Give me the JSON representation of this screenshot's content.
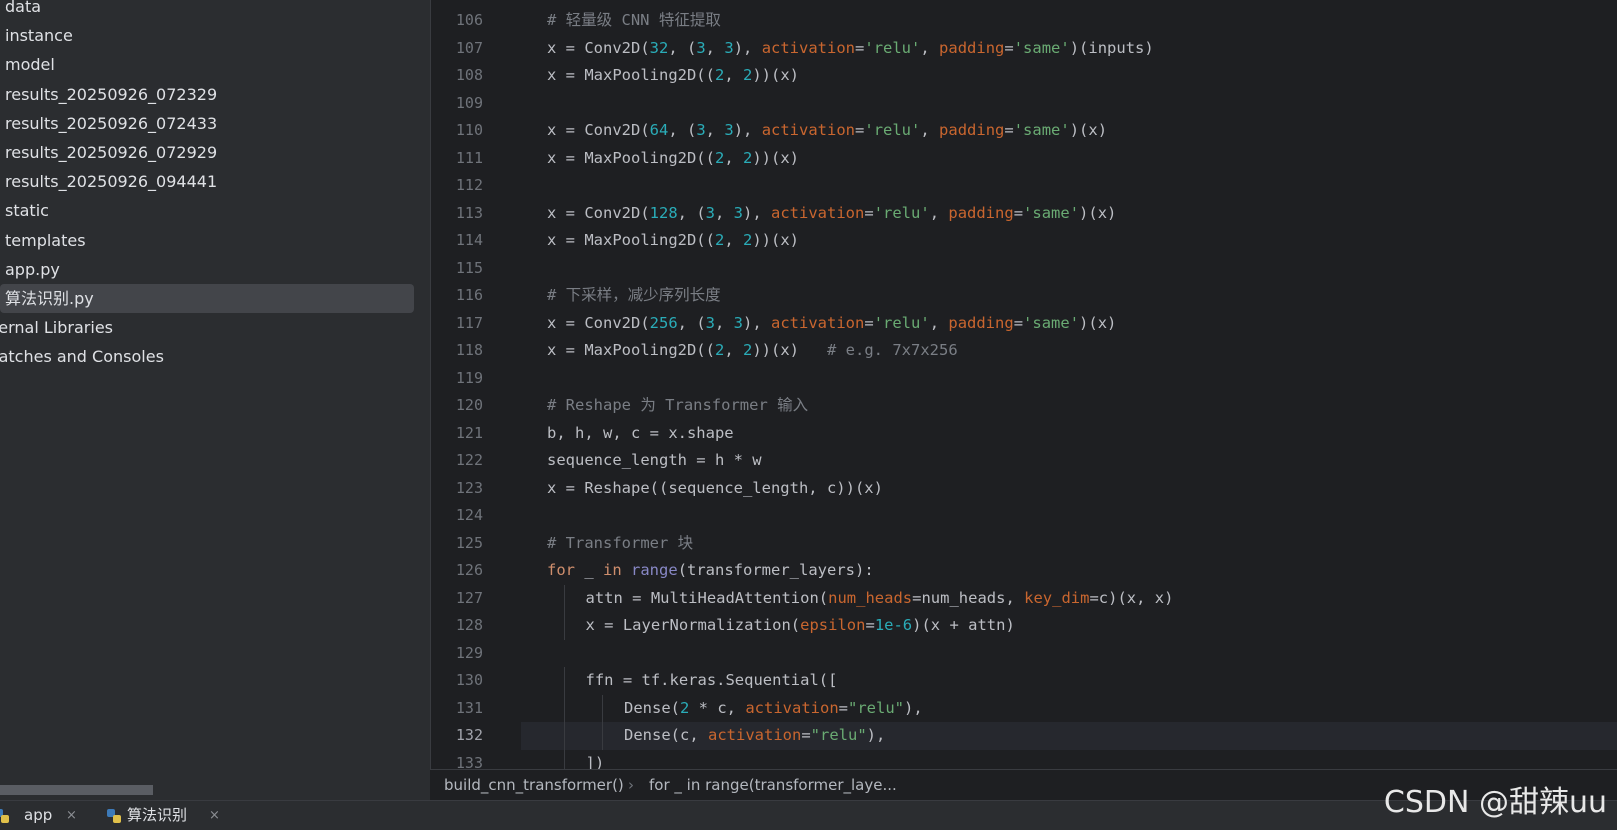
{
  "project_tree": {
    "items": [
      {
        "label": "data"
      },
      {
        "label": "instance"
      },
      {
        "label": "model"
      },
      {
        "label": "results_20250926_072329"
      },
      {
        "label": "results_20250926_072433"
      },
      {
        "label": "results_20250926_072929"
      },
      {
        "label": "results_20250926_094441"
      },
      {
        "label": "static"
      },
      {
        "label": "templates"
      },
      {
        "label": "app.py"
      },
      {
        "label": "算法识别.py"
      },
      {
        "label": "ternal Libraries"
      },
      {
        "label": "ratches and Consoles"
      }
    ],
    "selected": "算法识别.py"
  },
  "editor": {
    "current_line": 132,
    "lines": [
      {
        "n": "106",
        "indent": 1,
        "tokens": [
          [
            "c-cmt",
            "# 轻量级 CNN 特征提取"
          ]
        ]
      },
      {
        "n": "107",
        "indent": 1,
        "tokens": [
          [
            "c-plain",
            "x = Conv2D("
          ],
          [
            "c-num",
            "32"
          ],
          [
            "c-plain",
            ", ("
          ],
          [
            "c-num",
            "3"
          ],
          [
            "c-plain",
            ", "
          ],
          [
            "c-num",
            "3"
          ],
          [
            "c-plain",
            "), "
          ],
          [
            "c-param",
            "activation"
          ],
          [
            "c-plain",
            "="
          ],
          [
            "c-str",
            "'relu'"
          ],
          [
            "c-plain",
            ", "
          ],
          [
            "c-param",
            "padding"
          ],
          [
            "c-plain",
            "="
          ],
          [
            "c-str",
            "'same'"
          ],
          [
            "c-plain",
            ")(inputs)"
          ]
        ]
      },
      {
        "n": "108",
        "indent": 1,
        "tokens": [
          [
            "c-plain",
            "x = MaxPooling2D(("
          ],
          [
            "c-num",
            "2"
          ],
          [
            "c-plain",
            ", "
          ],
          [
            "c-num",
            "2"
          ],
          [
            "c-plain",
            "))(x)"
          ]
        ]
      },
      {
        "n": "109",
        "indent": 0,
        "tokens": []
      },
      {
        "n": "110",
        "indent": 1,
        "tokens": [
          [
            "c-plain",
            "x = Conv2D("
          ],
          [
            "c-num",
            "64"
          ],
          [
            "c-plain",
            ", ("
          ],
          [
            "c-num",
            "3"
          ],
          [
            "c-plain",
            ", "
          ],
          [
            "c-num",
            "3"
          ],
          [
            "c-plain",
            "), "
          ],
          [
            "c-param",
            "activation"
          ],
          [
            "c-plain",
            "="
          ],
          [
            "c-str",
            "'relu'"
          ],
          [
            "c-plain",
            ", "
          ],
          [
            "c-param",
            "padding"
          ],
          [
            "c-plain",
            "="
          ],
          [
            "c-str",
            "'same'"
          ],
          [
            "c-plain",
            ")(x)"
          ]
        ]
      },
      {
        "n": "111",
        "indent": 1,
        "tokens": [
          [
            "c-plain",
            "x = MaxPooling2D(("
          ],
          [
            "c-num",
            "2"
          ],
          [
            "c-plain",
            ", "
          ],
          [
            "c-num",
            "2"
          ],
          [
            "c-plain",
            "))(x)"
          ]
        ]
      },
      {
        "n": "112",
        "indent": 0,
        "tokens": []
      },
      {
        "n": "113",
        "indent": 1,
        "tokens": [
          [
            "c-plain",
            "x = Conv2D("
          ],
          [
            "c-num",
            "128"
          ],
          [
            "c-plain",
            ", ("
          ],
          [
            "c-num",
            "3"
          ],
          [
            "c-plain",
            ", "
          ],
          [
            "c-num",
            "3"
          ],
          [
            "c-plain",
            "), "
          ],
          [
            "c-param",
            "activation"
          ],
          [
            "c-plain",
            "="
          ],
          [
            "c-str",
            "'relu'"
          ],
          [
            "c-plain",
            ", "
          ],
          [
            "c-param",
            "padding"
          ],
          [
            "c-plain",
            "="
          ],
          [
            "c-str",
            "'same'"
          ],
          [
            "c-plain",
            ")(x)"
          ]
        ]
      },
      {
        "n": "114",
        "indent": 1,
        "tokens": [
          [
            "c-plain",
            "x = MaxPooling2D(("
          ],
          [
            "c-num",
            "2"
          ],
          [
            "c-plain",
            ", "
          ],
          [
            "c-num",
            "2"
          ],
          [
            "c-plain",
            "))(x)"
          ]
        ]
      },
      {
        "n": "115",
        "indent": 0,
        "tokens": []
      },
      {
        "n": "116",
        "indent": 1,
        "tokens": [
          [
            "c-cmt",
            "# 下采样，减少序列长度"
          ]
        ]
      },
      {
        "n": "117",
        "indent": 1,
        "tokens": [
          [
            "c-plain",
            "x = Conv2D("
          ],
          [
            "c-num",
            "256"
          ],
          [
            "c-plain",
            ", ("
          ],
          [
            "c-num",
            "3"
          ],
          [
            "c-plain",
            ", "
          ],
          [
            "c-num",
            "3"
          ],
          [
            "c-plain",
            "), "
          ],
          [
            "c-param",
            "activation"
          ],
          [
            "c-plain",
            "="
          ],
          [
            "c-str",
            "'relu'"
          ],
          [
            "c-plain",
            ", "
          ],
          [
            "c-param",
            "padding"
          ],
          [
            "c-plain",
            "="
          ],
          [
            "c-str",
            "'same'"
          ],
          [
            "c-plain",
            ")(x)"
          ]
        ]
      },
      {
        "n": "118",
        "indent": 1,
        "tokens": [
          [
            "c-plain",
            "x = MaxPooling2D(("
          ],
          [
            "c-num",
            "2"
          ],
          [
            "c-plain",
            ", "
          ],
          [
            "c-num",
            "2"
          ],
          [
            "c-plain",
            "))(x)   "
          ],
          [
            "c-cmt",
            "# e.g. 7x7x256"
          ]
        ]
      },
      {
        "n": "119",
        "indent": 0,
        "tokens": []
      },
      {
        "n": "120",
        "indent": 1,
        "tokens": [
          [
            "c-cmt",
            "# Reshape 为 Transformer 输入"
          ]
        ]
      },
      {
        "n": "121",
        "indent": 1,
        "tokens": [
          [
            "c-plain",
            "b, h, w, c = x.shape"
          ]
        ]
      },
      {
        "n": "122",
        "indent": 1,
        "tokens": [
          [
            "c-plain",
            "sequence_length = h * w"
          ]
        ]
      },
      {
        "n": "123",
        "indent": 1,
        "tokens": [
          [
            "c-plain",
            "x = Reshape((sequence_length, c))(x)"
          ]
        ]
      },
      {
        "n": "124",
        "indent": 0,
        "tokens": []
      },
      {
        "n": "125",
        "indent": 1,
        "tokens": [
          [
            "c-cmt",
            "# Transformer 块"
          ]
        ]
      },
      {
        "n": "126",
        "indent": 1,
        "tokens": [
          [
            "c-kw",
            "for"
          ],
          [
            "c-plain",
            " _ "
          ],
          [
            "c-kw",
            "in"
          ],
          [
            "c-plain",
            " "
          ],
          [
            "c-bi",
            "range"
          ],
          [
            "c-plain",
            "(transformer_layers):"
          ]
        ]
      },
      {
        "n": "127",
        "indent": 2,
        "tokens": [
          [
            "c-plain",
            "attn = MultiHeadAttention("
          ],
          [
            "c-param",
            "num_heads"
          ],
          [
            "c-plain",
            "=num_heads, "
          ],
          [
            "c-param",
            "key_dim"
          ],
          [
            "c-plain",
            "=c)(x, x)"
          ]
        ]
      },
      {
        "n": "128",
        "indent": 2,
        "tokens": [
          [
            "c-plain",
            "x = LayerNormalization("
          ],
          [
            "c-param",
            "epsilon"
          ],
          [
            "c-plain",
            "="
          ],
          [
            "c-num",
            "1e-6"
          ],
          [
            "c-plain",
            ")(x + attn)"
          ]
        ]
      },
      {
        "n": "129",
        "indent": 0,
        "tokens": []
      },
      {
        "n": "130",
        "indent": 2,
        "tokens": [
          [
            "c-plain",
            "ffn = tf.keras.Sequential(["
          ]
        ]
      },
      {
        "n": "131",
        "indent": 3,
        "tokens": [
          [
            "c-plain",
            "Dense("
          ],
          [
            "c-num",
            "2"
          ],
          [
            "c-plain",
            " * c, "
          ],
          [
            "c-param",
            "activation"
          ],
          [
            "c-plain",
            "="
          ],
          [
            "c-str",
            "\"relu\""
          ],
          [
            "c-plain",
            "),"
          ]
        ]
      },
      {
        "n": "132",
        "indent": 3,
        "tokens": [
          [
            "c-plain",
            "Dense(c, "
          ],
          [
            "c-param",
            "activation"
          ],
          [
            "c-plain",
            "="
          ],
          [
            "c-str",
            "\"relu\""
          ],
          [
            "c-plain",
            "),"
          ]
        ]
      },
      {
        "n": "133",
        "indent": 2,
        "tokens": [
          [
            "c-plain",
            "])"
          ]
        ]
      }
    ]
  },
  "breadcrumb": {
    "function": "build_cnn_transformer()",
    "separator": "›",
    "block": "for _ in range(transformer_laye..."
  },
  "tabs": [
    {
      "label": "app",
      "close": "×"
    },
    {
      "label": "算法识别",
      "close": "×"
    }
  ],
  "watermark": "CSDN @甜辣uu"
}
